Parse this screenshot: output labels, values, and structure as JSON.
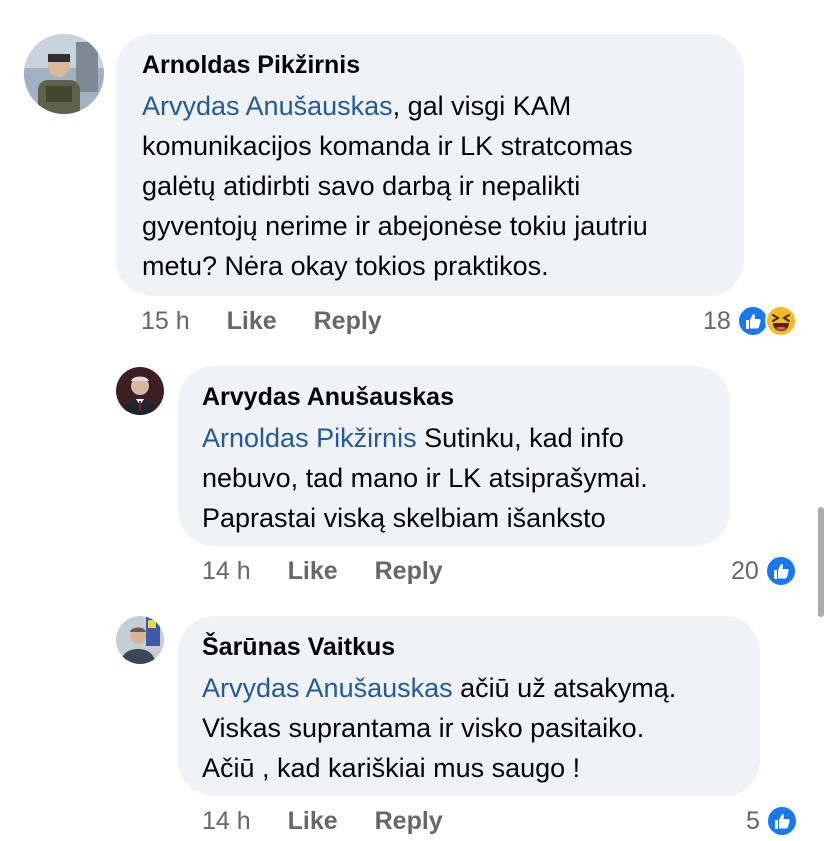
{
  "comments": [
    {
      "author": "Arnoldas Pikžirnis",
      "mention": "Arvydas Anušauskas",
      "text_lines": [
        ", gal visgi KAM",
        "komunikacijos komanda ir LK stratcomas",
        "galėtų atidirbti savo darbą ir nepalikti",
        "gyventojų nerime ir abejonėse tokiu jautriu",
        "metu? Nėra okay tokios praktikos."
      ],
      "time": "15 h",
      "like_label": "Like",
      "reply_label": "Reply",
      "reaction_count": "18",
      "reactions": [
        "like-icon",
        "haha-icon"
      ]
    },
    {
      "author": "Arvydas Anušauskas",
      "mention": "Arnoldas Pikžirnis",
      "text_lines": [
        " Sutinku, kad info",
        "nebuvo, tad mano ir LK atsiprašymai.",
        "Paprastai viską skelbiam išanksto"
      ],
      "time": "14 h",
      "like_label": "Like",
      "reply_label": "Reply",
      "reaction_count": "20",
      "reactions": [
        "like-icon"
      ]
    },
    {
      "author": "Šarūnas Vaitkus",
      "mention": "Arvydas Anušauskas",
      "text_lines": [
        " ačiū už atsakymą.",
        "Viskas suprantama ir visko pasitaiko.",
        "Ačiū , kad kariškiai mus saugo !"
      ],
      "time": "14 h",
      "like_label": "Like",
      "reply_label": "Reply",
      "reaction_count": "5",
      "reactions": [
        "like-icon"
      ]
    }
  ],
  "colors": {
    "bubble": "#f0f2f5",
    "mention": "#225a9f",
    "meta": "#65676b",
    "like_blue": "#1877f2",
    "haha_yellow": "#f7b928"
  }
}
